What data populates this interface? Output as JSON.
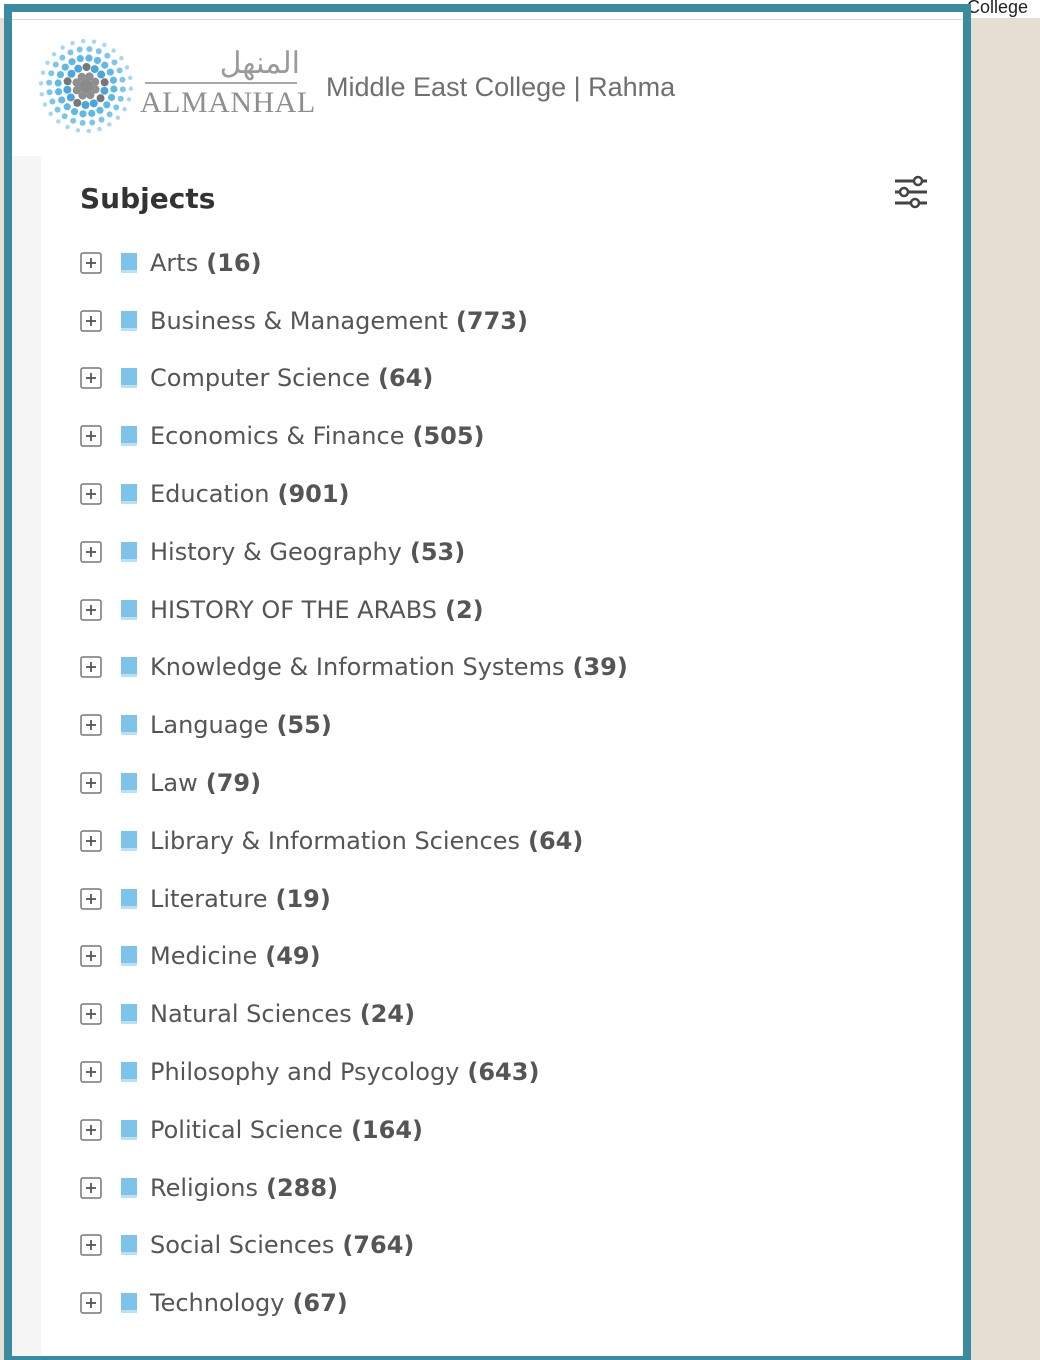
{
  "background": {
    "corner_text": "College"
  },
  "header": {
    "logo_arabic": "المنهل",
    "logo_latin": "ALMANHAL",
    "institution": "Middle East College | Rahma"
  },
  "panel": {
    "title": "Subjects",
    "filter_icon": "sliders-icon",
    "subjects": [
      {
        "name": "Arts",
        "count": "(16)"
      },
      {
        "name": "Business & Management",
        "count": "(773)"
      },
      {
        "name": "Computer Science",
        "count": "(64)"
      },
      {
        "name": "Economics & Finance",
        "count": "(505)"
      },
      {
        "name": "Education",
        "count": "(901)"
      },
      {
        "name": "History & Geography",
        "count": "(53)"
      },
      {
        "name": "HISTORY OF THE ARABS",
        "count": "(2)"
      },
      {
        "name": "Knowledge & Information Systems",
        "count": "(39)"
      },
      {
        "name": "Language",
        "count": "(55)"
      },
      {
        "name": "Law",
        "count": "(79)"
      },
      {
        "name": "Library & Information Sciences",
        "count": "(64)"
      },
      {
        "name": "Literature",
        "count": "(19)"
      },
      {
        "name": "Medicine",
        "count": "(49)"
      },
      {
        "name": "Natural Sciences",
        "count": "(24)"
      },
      {
        "name": "Philosophy and Psycology",
        "count": "(643)"
      },
      {
        "name": "Political Science",
        "count": "(164)"
      },
      {
        "name": "Religions",
        "count": "(288)"
      },
      {
        "name": "Social Sciences",
        "count": "(764)"
      },
      {
        "name": "Technology",
        "count": "(67)"
      }
    ]
  },
  "colors": {
    "frame_border": "#3a8ba0",
    "folder_icon": "#7ec4ea",
    "text": "#555555",
    "page_background": "#e6ded2"
  }
}
